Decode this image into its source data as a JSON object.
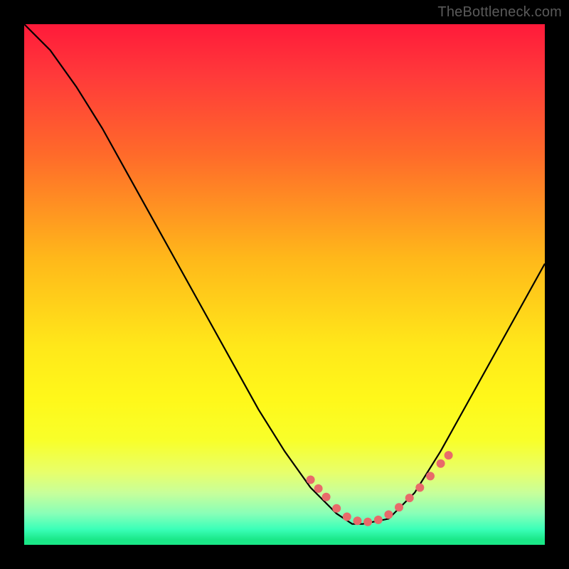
{
  "watermark": "TheBottleneck.com",
  "chart_data": {
    "type": "line",
    "title": "",
    "xlabel": "",
    "ylabel": "",
    "xlim": [
      0,
      100
    ],
    "ylim": [
      0,
      100
    ],
    "curve": {
      "x": [
        0,
        5,
        10,
        15,
        20,
        25,
        30,
        35,
        40,
        45,
        50,
        55,
        57,
        60,
        63,
        65,
        70,
        75,
        80,
        85,
        90,
        95,
        100
      ],
      "y": [
        100,
        95,
        88,
        80,
        71,
        62,
        53,
        44,
        35,
        26,
        18,
        11,
        9,
        6,
        4,
        4,
        5,
        10,
        18,
        27,
        36,
        45,
        54
      ]
    },
    "markers": {
      "x": [
        55,
        56.5,
        58,
        60,
        62,
        64,
        66,
        68,
        70,
        72,
        74,
        76,
        78,
        80,
        81.5
      ],
      "y": [
        12.5,
        10.8,
        9.2,
        7,
        5.4,
        4.6,
        4.4,
        4.8,
        5.8,
        7.2,
        9,
        11,
        13.2,
        15.6,
        17.2
      ],
      "color": "#e86a6a",
      "radius": 6
    }
  }
}
